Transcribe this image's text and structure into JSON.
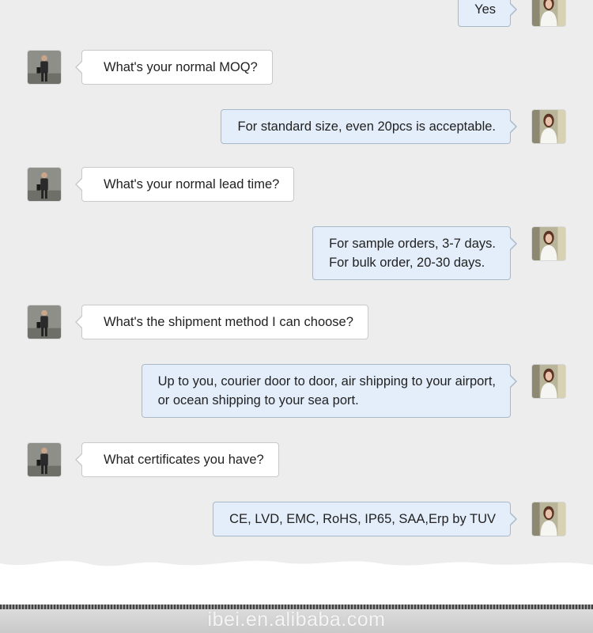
{
  "colors": {
    "page_background": "#ededed",
    "customer_bubble": "#ffffff",
    "seller_bubble": "#e3eefa"
  },
  "messages": [
    {
      "side": "right",
      "avatar": "seller-avatar",
      "text": "Yes"
    },
    {
      "side": "left",
      "avatar": "customer-avatar",
      "text": "What's your normal MOQ?"
    },
    {
      "side": "right",
      "avatar": "seller-avatar",
      "text": "For standard size, even 20pcs is acceptable."
    },
    {
      "side": "left",
      "avatar": "customer-avatar",
      "text": "What's your normal lead time?"
    },
    {
      "side": "right",
      "avatar": "seller-avatar",
      "text": "For sample orders, 3-7 days.\nFor bulk order, 20-30 days."
    },
    {
      "side": "left",
      "avatar": "customer-avatar",
      "text": "What's the shipment method I can choose?"
    },
    {
      "side": "right",
      "avatar": "seller-avatar",
      "text": "Up to you, courier door to door, air shipping to your airport,\nor ocean shipping to your sea port."
    },
    {
      "side": "left",
      "avatar": "customer-avatar",
      "text": "What certificates you have?"
    },
    {
      "side": "right",
      "avatar": "seller-avatar",
      "text": "CE, LVD, EMC, RoHS, IP65, SAA,Erp by TUV"
    }
  ],
  "footer": {
    "watermark": "ibei.en.alibaba.com"
  }
}
